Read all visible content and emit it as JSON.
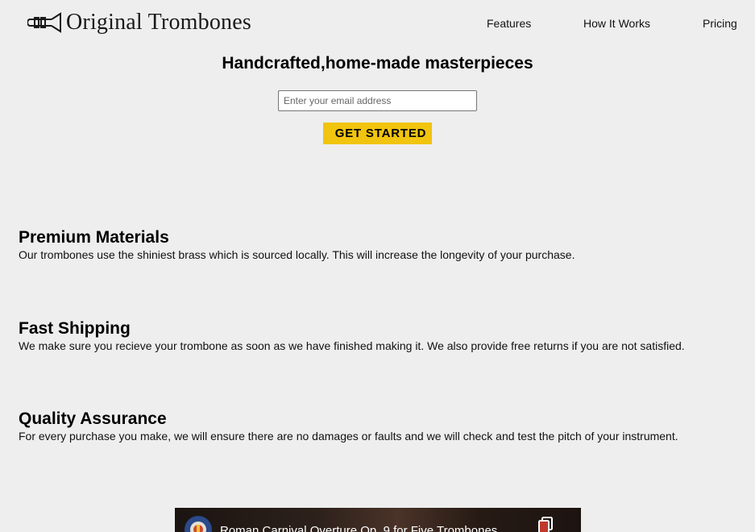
{
  "header": {
    "brand": "Original Trombones",
    "logo_icon": "trombone-logo-icon",
    "nav": [
      "Features",
      "How It Works",
      "Pricing"
    ]
  },
  "hero": {
    "title": "Handcrafted,home-made masterpieces",
    "email_placeholder": "Enter your email address",
    "cta_label": "GET STARTED"
  },
  "features": [
    {
      "title": "Premium Materials",
      "text": "Our trombones use the shiniest brass which is sourced locally. This will increase the longevity of your purchase."
    },
    {
      "title": "Fast Shipping",
      "text": "We make sure you recieve your trombone as soon as we have finished making it. We also provide free returns if you are not satisfied."
    },
    {
      "title": "Quality Assurance",
      "text": "For every purchase you make, we will ensure there are no damages or faults and we will check and test the pitch of your instrument."
    }
  ],
  "video": {
    "title": "Roman Carnival Overture Op. 9 for Five Trombones",
    "channel_icon": "channel-avatar-icon",
    "copy_icon": "copy-link-icon"
  },
  "colors": {
    "background": "#eeeeee",
    "cta": "#f1c40f"
  }
}
